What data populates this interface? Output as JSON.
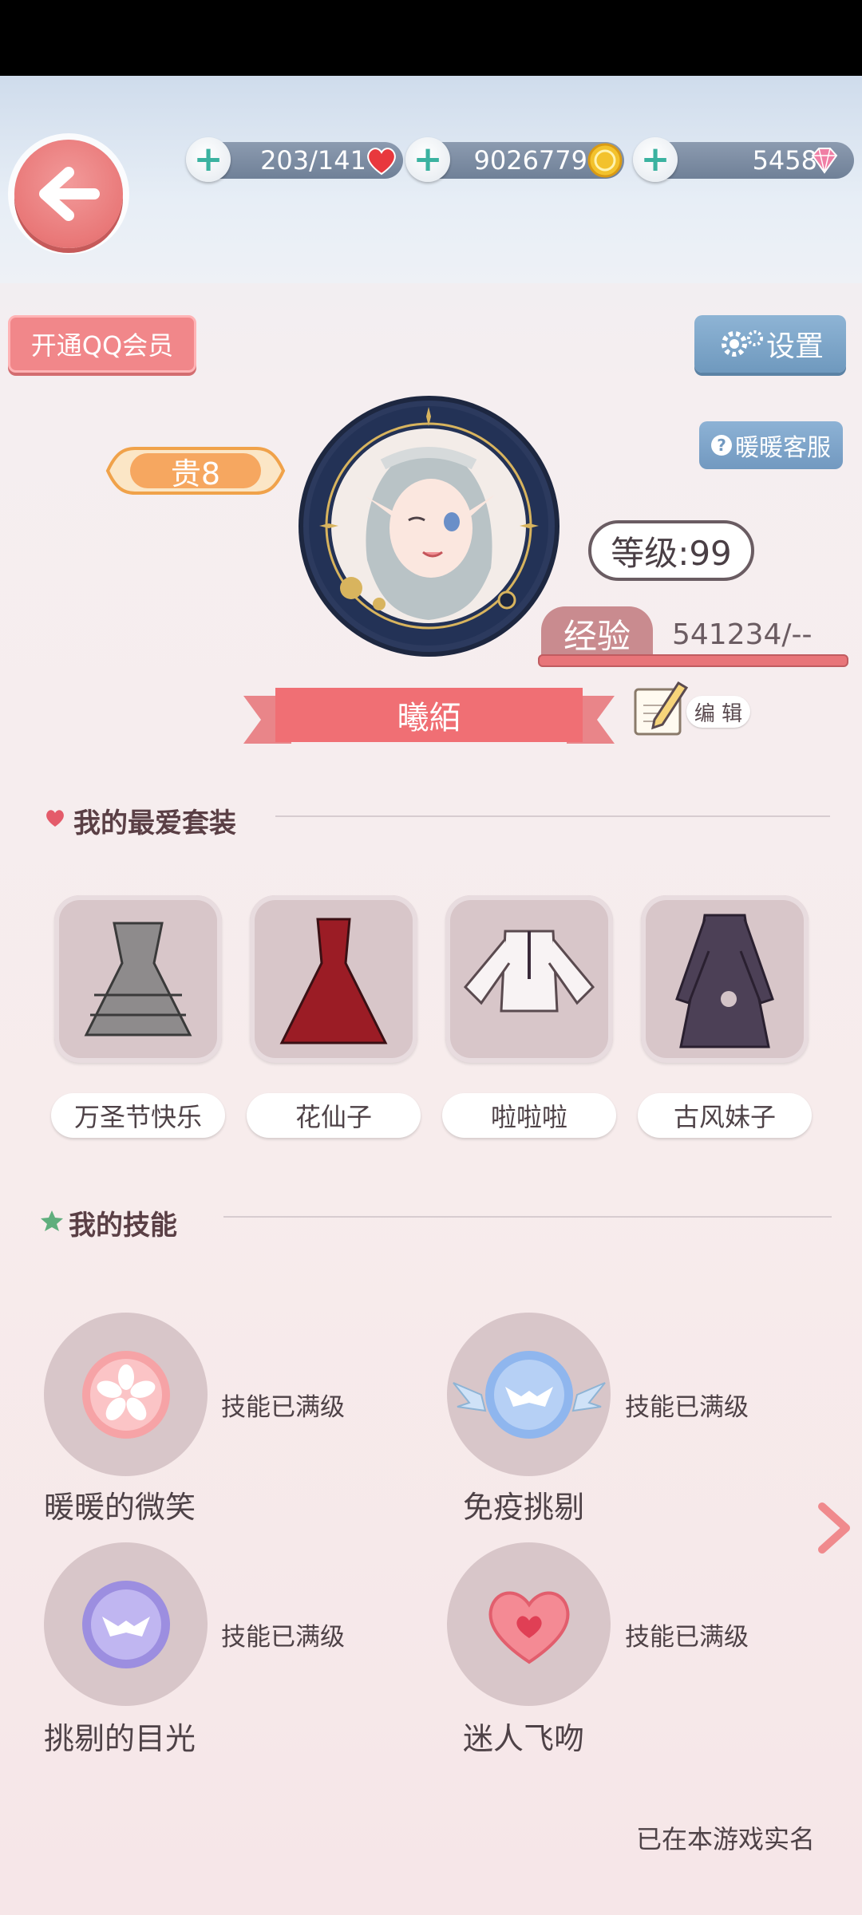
{
  "resources": {
    "hearts": "203/141",
    "coins": "9026779",
    "diamonds": "5458"
  },
  "buttons": {
    "vip": "开通QQ会员",
    "settings": "设置",
    "service": "暖暖客服",
    "edit": "编 辑"
  },
  "profile": {
    "noble": "贵8",
    "level": "等级:99",
    "exp_label": "经验",
    "exp_value": "541234/--",
    "name": "曦絔"
  },
  "favorites": {
    "title": "我的最爱套装",
    "items": [
      {
        "name": "万圣节快乐"
      },
      {
        "name": "花仙子"
      },
      {
        "name": "啦啦啦"
      },
      {
        "name": "古风妹子"
      }
    ]
  },
  "skills": {
    "title": "我的技能",
    "items": [
      {
        "name": "暖暖的微笑",
        "status": "技能已满级",
        "icon": "sakura-icon"
      },
      {
        "name": "免疫挑剔",
        "status": "技能已满级",
        "icon": "winged-mask-icon"
      },
      {
        "name": "挑剔的目光",
        "status": "技能已满级",
        "icon": "mask-icon"
      },
      {
        "name": "迷人飞吻",
        "status": "技能已满级",
        "icon": "heart-icon"
      }
    ]
  },
  "footer": {
    "realname": "已在本游戏实名"
  },
  "colors": {
    "accent": "#e97878",
    "blue_button": "#7299c0",
    "card_bg": "#d8c6c9"
  }
}
